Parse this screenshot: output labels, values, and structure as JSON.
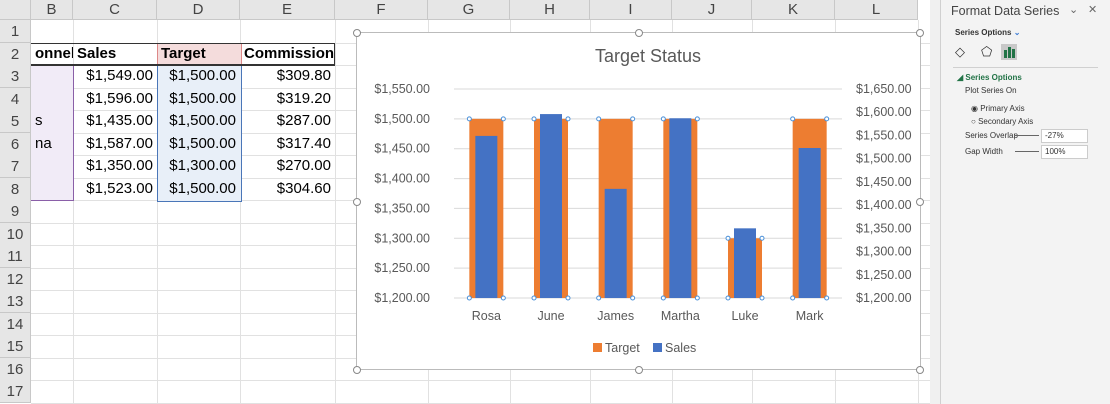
{
  "columns": [
    "B",
    "C",
    "D",
    "E",
    "F",
    "G",
    "H",
    "I",
    "J",
    "K",
    "L"
  ],
  "rows": [
    "1",
    "2",
    "3",
    "4",
    "5",
    "6",
    "7",
    "8",
    "9",
    "10",
    "11",
    "12",
    "13",
    "14",
    "15",
    "16",
    "17"
  ],
  "table": {
    "headers": [
      "onnel",
      "Sales",
      "Target",
      "Commission"
    ],
    "rows": [
      [
        "",
        "$1,549.00",
        "$1,500.00",
        "$309.80"
      ],
      [
        "",
        "$1,596.00",
        "$1,500.00",
        "$319.20"
      ],
      [
        "s",
        "$1,435.00",
        "$1,500.00",
        "$287.00"
      ],
      [
        "na",
        "$1,587.00",
        "$1,500.00",
        "$317.40"
      ],
      [
        "",
        "$1,350.00",
        "$1,300.00",
        "$270.00"
      ],
      [
        "",
        "$1,523.00",
        "$1,500.00",
        "$304.60"
      ]
    ]
  },
  "chart_data": {
    "type": "bar",
    "title": "Target Status",
    "categories": [
      "Rosa",
      "June",
      "James",
      "Martha",
      "Luke",
      "Mark"
    ],
    "series": [
      {
        "name": "Target",
        "axis": "primary",
        "color": "#ed7d31",
        "values": [
          1500,
          1500,
          1500,
          1500,
          1300,
          1500
        ]
      },
      {
        "name": "Sales",
        "axis": "secondary",
        "color": "#4472c4",
        "values": [
          1549,
          1596,
          1435,
          1587,
          1350,
          1523
        ]
      }
    ],
    "primary_axis": {
      "range": [
        1200,
        1550
      ],
      "ticks": [
        "$1,200.00",
        "$1,250.00",
        "$1,300.00",
        "$1,350.00",
        "$1,400.00",
        "$1,450.00",
        "$1,500.00",
        "$1,550.00"
      ]
    },
    "secondary_axis": {
      "range": [
        1200,
        1650
      ],
      "ticks": [
        "$1,200.00",
        "$1,250.00",
        "$1,300.00",
        "$1,350.00",
        "$1,400.00",
        "$1,450.00",
        "$1,500.00",
        "$1,550.00",
        "$1,600.00",
        "$1,650.00"
      ]
    },
    "legend": "bottom",
    "grid": true
  },
  "pane": {
    "title": "Format Data Series",
    "dropdown": "Series Options",
    "section": "Series Options",
    "plot_on": "Plot Series On",
    "primary": "Primary Axis",
    "secondary": "Secondary Axis",
    "overlap_label": "Series Overlap",
    "overlap_value": "-27%",
    "gap_label": "Gap Width",
    "gap_value": "100%"
  }
}
